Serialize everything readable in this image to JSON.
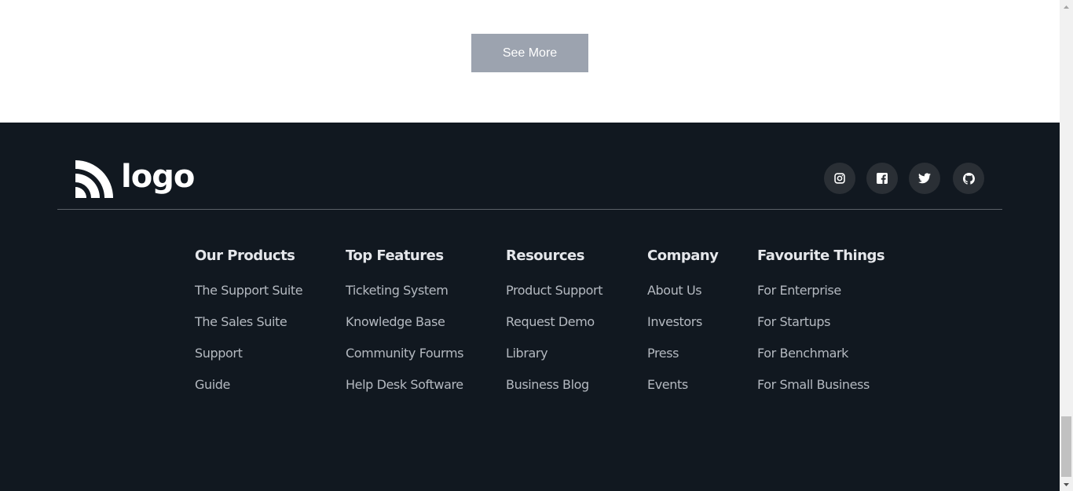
{
  "main": {
    "see_more_label": "See More"
  },
  "footer": {
    "logo_text": "logo",
    "socials": [
      "instagram-icon",
      "facebook-icon",
      "twitter-icon",
      "github-icon"
    ],
    "columns": [
      {
        "title": "Our Products",
        "links": [
          "The Support Suite",
          "The Sales Suite",
          "Support",
          "Guide"
        ]
      },
      {
        "title": "Top Features",
        "links": [
          "Ticketing System",
          "Knowledge Base",
          "Community Fourms",
          "Help Desk Software"
        ]
      },
      {
        "title": "Resources",
        "links": [
          "Product Support",
          "Request Demo",
          "Library",
          "Business Blog"
        ]
      },
      {
        "title": "Company",
        "links": [
          "About Us",
          "Investors",
          "Press",
          "Events"
        ]
      },
      {
        "title": "Favourite Things",
        "links": [
          "For Enterprise",
          "For Startups",
          "For Benchmark",
          "For Small Business"
        ]
      }
    ]
  },
  "colors": {
    "footer_bg": "#111820",
    "button_bg": "#9ca3af",
    "link": "#b4b9c0",
    "heading": "#e5e7eb"
  }
}
